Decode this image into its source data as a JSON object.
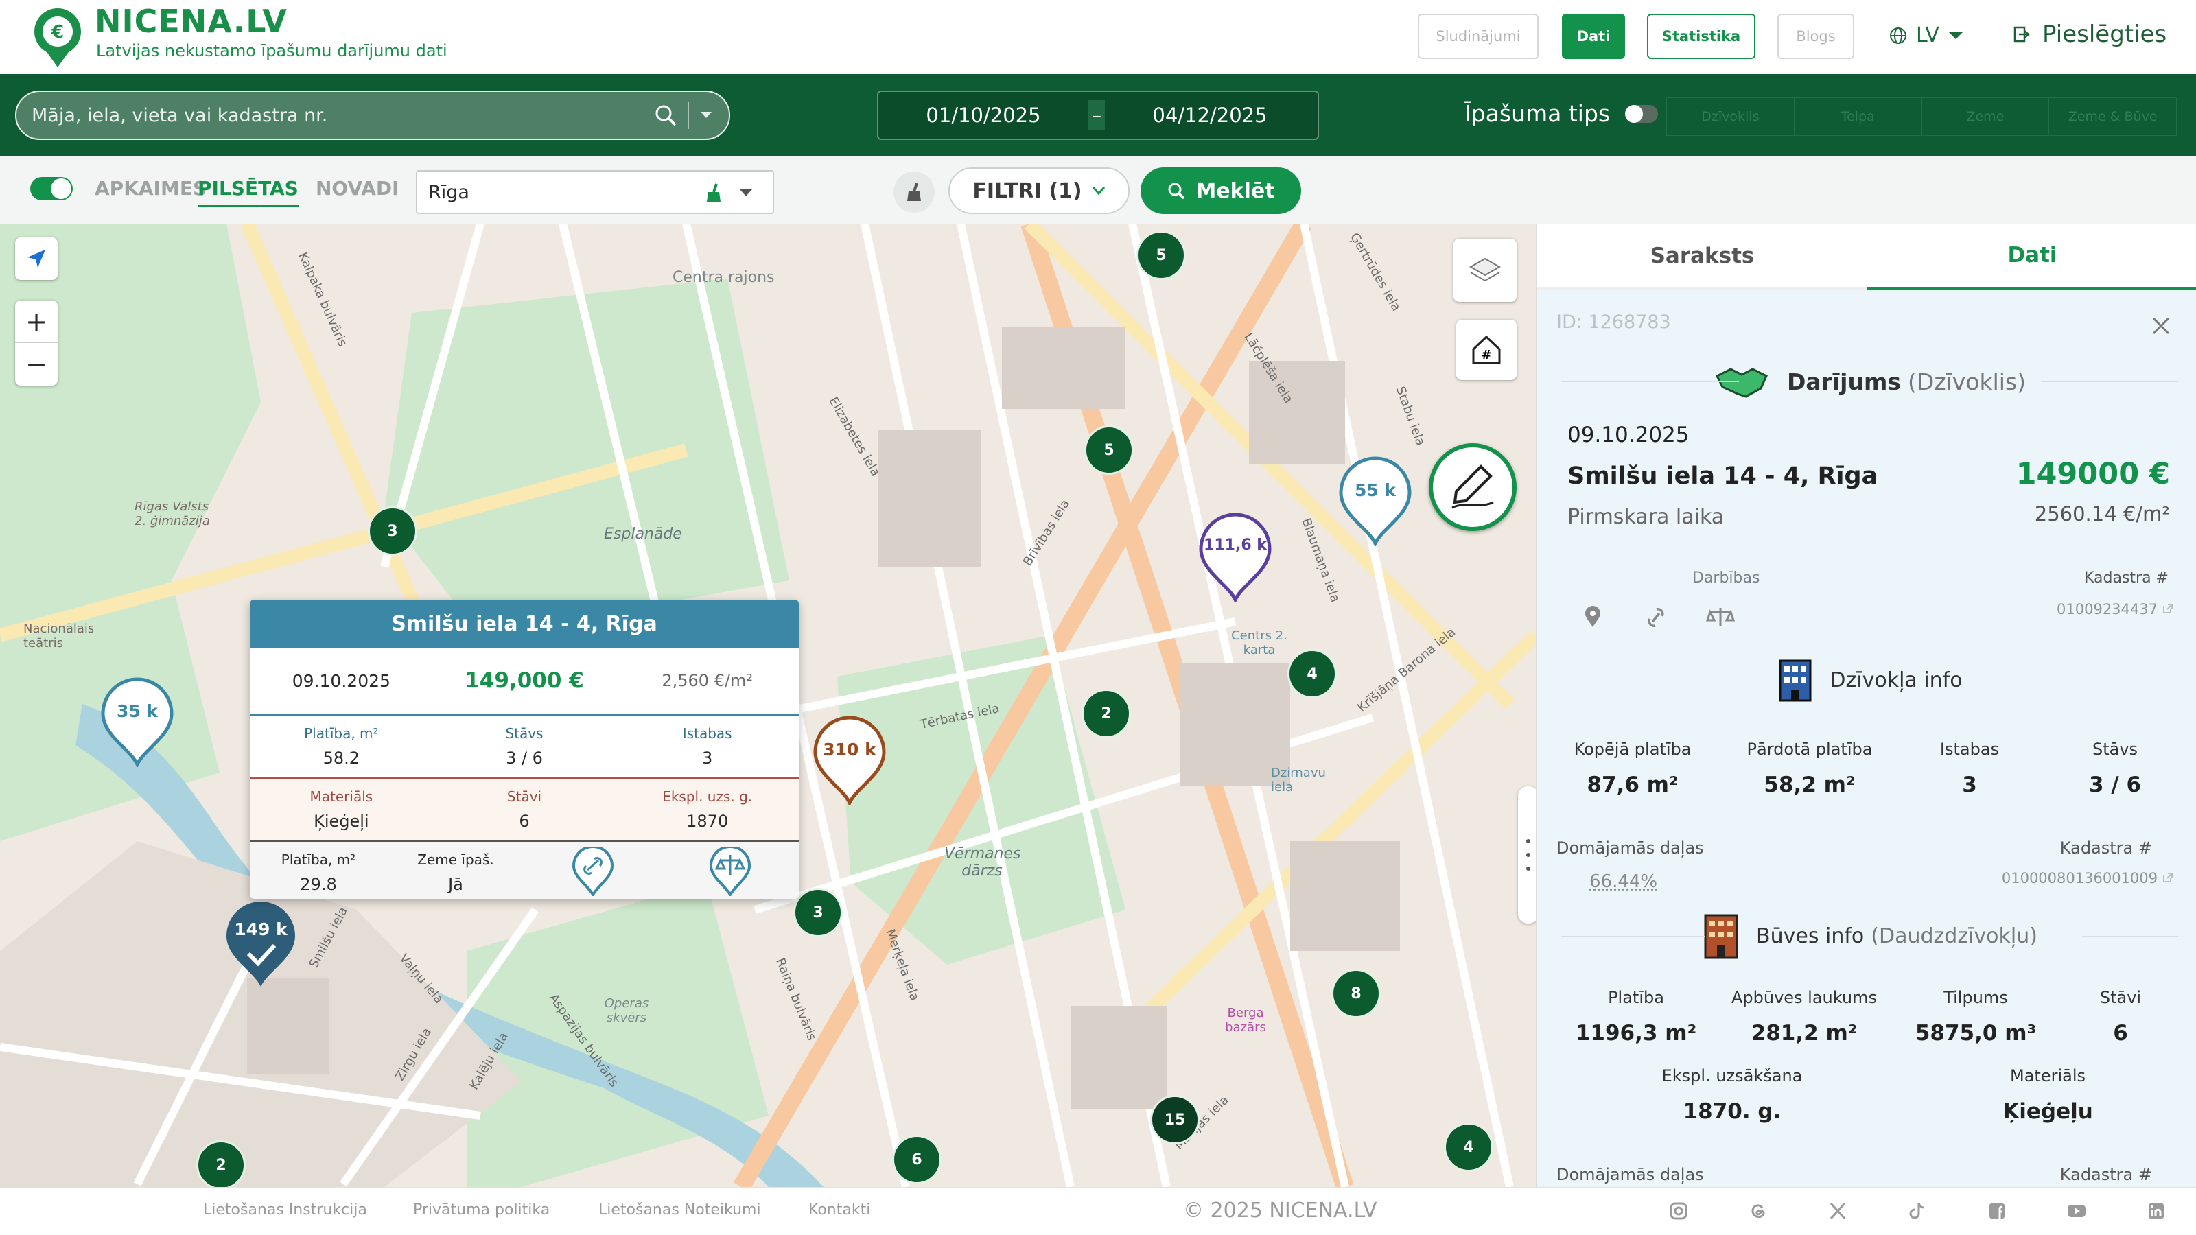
{
  "header": {
    "brand": "NICENA.LV",
    "tagline": "Latvijas nekustamo īpašumu darījumu dati",
    "nav": [
      "Sludinājumi",
      "Dati",
      "Statistika",
      "Blogs"
    ],
    "lang": "LV",
    "login": "Pieslēgties"
  },
  "search": {
    "placeholder": "Māja, iela, vieta vai kadastra nr.",
    "date_from": "01/10/2025",
    "date_sep": "–",
    "date_to": "04/12/2025",
    "ptype_label": "Īpašuma tips",
    "ptype_tabs": [
      "Dzīvoklis",
      "Telpa",
      "Zeme",
      "Zeme & Būve"
    ]
  },
  "filters": {
    "scopes": [
      "APKAIMES",
      "PILSĒTAS",
      "NOVADI"
    ],
    "active_scope": "PILSĒTAS",
    "city": "Rīga",
    "filtri": "FILTRI (1)",
    "search_btn": "Meklēt"
  },
  "map": {
    "clusters": [
      {
        "n": "5"
      },
      {
        "n": "5"
      },
      {
        "n": "3"
      },
      {
        "n": "4"
      },
      {
        "n": "2"
      },
      {
        "n": "3"
      },
      {
        "n": "8"
      },
      {
        "n": "15"
      },
      {
        "n": "6"
      },
      {
        "n": "2"
      },
      {
        "n": "4"
      }
    ],
    "pins": [
      {
        "label": "35 k",
        "color": "#3a88a6"
      },
      {
        "label": "310 k",
        "color": "#9a4a1f"
      },
      {
        "label": "111,6 k",
        "color": "#5a3fa0"
      },
      {
        "label": "55 k",
        "color": "#3a88a6"
      },
      {
        "label": "149 k",
        "color": "#2e5d7a"
      }
    ],
    "labels": [
      "Centra rajons",
      "Esplanāde",
      "Vērmanes dārzs",
      "Rīgas Valsts 2. ģimnāzija",
      "Nacionālais teātris",
      "Centrs 2. karta",
      "Dzirnavu iela",
      "Berga bazārs",
      "Operas skvērs",
      "Krīšjāņa Barona iela",
      "Brīvības iela",
      "Elizabetes iela",
      "Tērbatas iela",
      "Merķeļa iela",
      "Raiņa bulvāris",
      "Kalpaka bulvāris",
      "Smilšu iela",
      "Vaļņu iela",
      "Zirgu iela",
      "Kalēju iela",
      "Marijas iela",
      "Lāčplēša iela",
      "Blaumaņa iela",
      "Stabu iela",
      "Ģertrūdes iela",
      "Aspazijas bulvāris"
    ],
    "popup": {
      "title": "Smilšu iela 14 - 4, Rīga",
      "date": "09.10.2025",
      "price": "149,000 €",
      "ppm": "2,560 €/m²",
      "row1": [
        {
          "k": "Platība, m²",
          "v": "58.2"
        },
        {
          "k": "Stāvs",
          "v": "3 / 6"
        },
        {
          "k": "Istabas",
          "v": "3"
        }
      ],
      "row2": [
        {
          "k": "Materiāls",
          "v": "Ķieģeļi"
        },
        {
          "k": "Stāvi",
          "v": "6"
        },
        {
          "k": "Ekspl. uzs. g.",
          "v": "1870"
        }
      ],
      "row3": [
        {
          "k": "Platība, m²",
          "v": "29.8"
        },
        {
          "k": "Zeme īpaš.",
          "v": "Jā"
        }
      ]
    }
  },
  "panel": {
    "tabs": [
      "Saraksts",
      "Dati"
    ],
    "id": "ID: 1268783",
    "deal_title": "Darījums",
    "deal_type": "(Dzīvoklis)",
    "date": "09.10.2025",
    "address": "Smilšu iela 14 - 4, Rīga",
    "price": "149000 €",
    "status": "Pirmskara laika",
    "ppm": "2560.14 €/m²",
    "actions_label": "Darbības",
    "kad_label": "Kadastra #",
    "kad1": "01009234437",
    "apt_title": "Dzīvokļa info",
    "apt": [
      {
        "k": "Kopējā platība",
        "v": "87,6 m²"
      },
      {
        "k": "Pārdotā platība",
        "v": "58,2 m²"
      },
      {
        "k": "Istabas",
        "v": "3"
      },
      {
        "k": "Stāvs",
        "v": "3 / 6"
      }
    ],
    "share_label": "Domājamās daļas",
    "share": "66.44%",
    "kad2": "01000080136001009",
    "bld_title": "Būves info",
    "bld_type": "(Daudzdzīvokļu)",
    "bld": [
      {
        "k": "Platība",
        "v": "1196,3 m²"
      },
      {
        "k": "Apbūves laukums",
        "v": "281,2 m²"
      },
      {
        "k": "Tilpums",
        "v": "5875,0 m³"
      },
      {
        "k": "Stāvi",
        "v": "6"
      }
    ],
    "bld2": [
      {
        "k": "Ekspl. uzsākšana",
        "v": "1870. g."
      },
      {
        "k": "Materiāls",
        "v": "Ķieģeļu"
      }
    ],
    "share_label2": "Domājamās daļas",
    "kad_label2": "Kadastra #"
  },
  "footer": {
    "links": [
      "Lietošanas Instrukcija",
      "Privātuma politika",
      "Lietošanas Noteikumi",
      "Kontakti"
    ],
    "copyright": "© 2025 NICENA.LV",
    "social": [
      "instagram-icon",
      "threads-icon",
      "x-icon",
      "tiktok-icon",
      "facebook-icon",
      "youtube-icon",
      "linkedin-icon"
    ]
  },
  "colors": {
    "brand": "#1a8f4a",
    "dark": "#0e5c34",
    "pin_blue": "#3a88a6",
    "price": "#12924a"
  }
}
